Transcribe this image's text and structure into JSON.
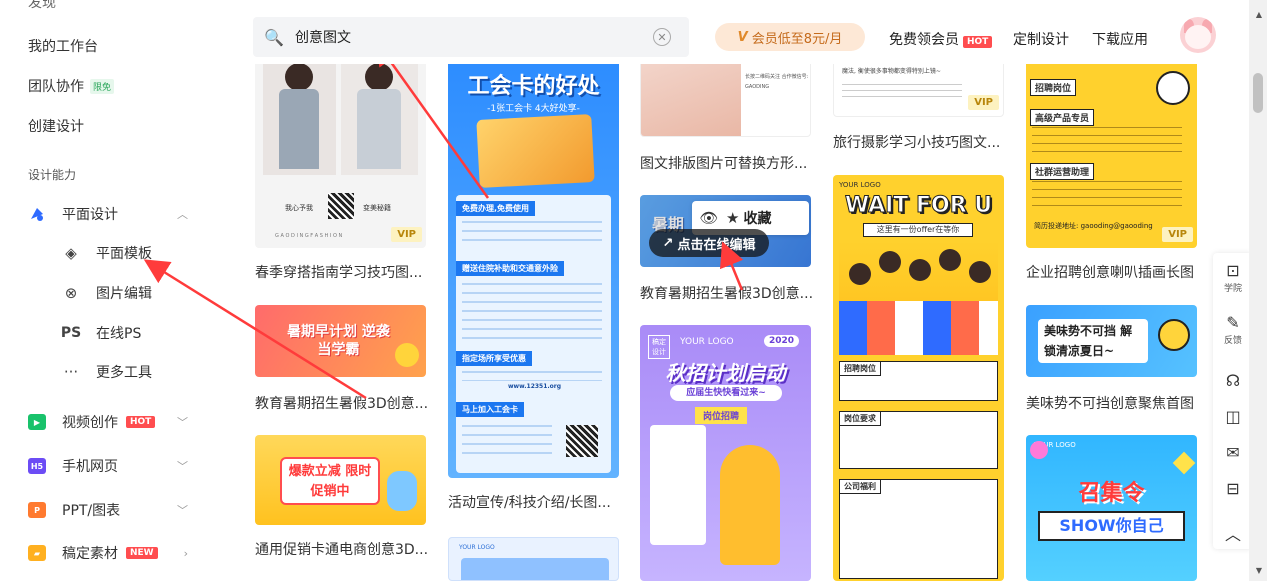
{
  "sidebar": {
    "top_cut": "发现",
    "workspace": "我的工作台",
    "team": "团队协作",
    "team_badge": "限免",
    "create": "创建设计",
    "section": "设计能力",
    "categories": [
      {
        "label": "平面设计",
        "icon": "graphic-design-icon",
        "color": "#2f6bff"
      },
      {
        "label": "视频创作",
        "icon": "video-icon",
        "color": "#19c26b",
        "badge": "HOT"
      },
      {
        "label": "手机网页",
        "icon": "h5-icon",
        "color": "#6c4cf5",
        "icon_text": "H5"
      },
      {
        "label": "PPT/图表",
        "icon": "ppt-icon",
        "color": "#ff7a2f",
        "icon_text": "P"
      },
      {
        "label": "稿定素材",
        "icon": "material-icon",
        "color": "#ffb020",
        "badge": "NEW"
      }
    ],
    "subitems": [
      {
        "label": "平面模板",
        "icon": "layers-icon"
      },
      {
        "label": "图片编辑",
        "icon": "image-edit-icon"
      },
      {
        "label": "在线PS",
        "icon": "ps-icon",
        "icon_text": "PS"
      },
      {
        "label": "更多工具",
        "icon": "more-icon"
      }
    ]
  },
  "header": {
    "search_value": "创意图文",
    "vip_text": "会员低至8元/月",
    "free_vip": "免费领会员",
    "hot": "HOT",
    "custom": "定制设计",
    "download": "下载应用"
  },
  "floatbar": {
    "items": [
      {
        "label": "学院",
        "icon": "academy-icon"
      },
      {
        "label": "反馈",
        "icon": "feedback-icon"
      },
      {
        "label": "",
        "icon": "headset-icon"
      },
      {
        "label": "",
        "icon": "compare-icon"
      },
      {
        "label": "",
        "icon": "inbox-icon"
      },
      {
        "label": "",
        "icon": "message-icon"
      },
      {
        "label": "",
        "icon": "up-icon"
      }
    ]
  },
  "cards": {
    "col1": [
      {
        "title": "春季穿搭指南学习技巧图...",
        "vip": "VIP"
      },
      {
        "title": "教育暑期招生暑假3D创意..."
      },
      {
        "title": "通用促销卡通电商创意3D..."
      }
    ],
    "col2": [
      {
        "title": "活动宣传/科技介绍/长图..."
      }
    ],
    "col3": [
      {
        "title": "图文排版图片可替换方形..."
      },
      {
        "title": "教育暑期招生暑假3D创意..."
      }
    ],
    "col4": [
      {
        "title": "旅行摄影学习小技巧图文...",
        "vip": "VIP"
      }
    ],
    "col5": [
      {
        "title": "企业招聘创意喇叭插画长图",
        "vip": "VIP"
      },
      {
        "title": "美味势不可挡创意聚焦首图"
      }
    ]
  },
  "card_texts": {
    "summer_plan": "暑期早计划 逆袭当学霸",
    "promo": "爆款立减 限时促销中",
    "union_title": "工会卡的好处",
    "union_sub": "-1张工会卡 4大好处享-",
    "union_s1": "免费办理,免费使用",
    "union_s2": "赠送住院补助和交通意外险",
    "union_s3": "指定场所享受优惠",
    "union_s4": "马上加入工会卡",
    "union_site": "www.12351.org",
    "edu3d": "暑期",
    "autumn_title": "秋招计划启动",
    "autumn_sub": "应届生快快看过来~",
    "autumn_post": "岗位招聘",
    "year": "2020",
    "your_logo": "YOUR LOGO",
    "wait_title": "WAIT FOR U",
    "wait_sub": "这里有一份offer在等你",
    "recruit_post": "招聘岗位",
    "recruit_req": "岗位要求",
    "welfare": "公司福利",
    "job_post": "招聘岗位",
    "senior_pm": "高级产品专员",
    "community": "社群运营助理",
    "email": "简历投递地址: gaooding@gaooding",
    "tasty": "美味势不可挡 解锁清凉夏日~",
    "gather": "召集令",
    "show": "SHOW你自己",
    "photo_text": "长按二维码关注 合作微信号: GAODING",
    "travel_text": "魔法, 衡使很多事物都变得特别上镜~",
    "fashion_left": "我心予我",
    "fashion_right": "变美秘籍",
    "fashion_brand": "G A O D I N G   F A S H I O N"
  },
  "overlay": {
    "favorite": "收藏",
    "edit": "点击在线编辑"
  },
  "colors": {
    "accent": "#ff4d4f",
    "vip_bg": "#fde8d6",
    "arrow": "#ff3b3b"
  }
}
